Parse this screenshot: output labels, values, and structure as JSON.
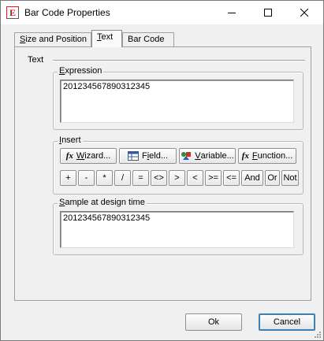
{
  "window": {
    "title": "Bar Code Properties",
    "icon_letter": "E"
  },
  "tabs": [
    {
      "label": "Size and Position",
      "underline": "S",
      "rest": "ize and Position",
      "active": false
    },
    {
      "label": "Text",
      "underline": "T",
      "rest": "ext",
      "active": true
    },
    {
      "label": "Bar Code",
      "underline": "",
      "rest": "Bar Code",
      "active": false
    }
  ],
  "panel": {
    "section_label": "Text",
    "expression": {
      "caption_underline": "E",
      "caption_rest": "xpression",
      "value": "201234567890312345"
    },
    "insert": {
      "caption_underline": "I",
      "caption_rest": "nsert",
      "wizard_u": "W",
      "wizard_rest": "izard...",
      "field_pre": "F",
      "field_u": "i",
      "field_rest": "eld...",
      "variable_u": "V",
      "variable_rest": "ariable...",
      "function_u": "F",
      "function_rest": "unction...",
      "operators": [
        "+",
        "-",
        "*",
        "/",
        "=",
        "<>",
        ">",
        "<",
        ">=",
        "<=",
        "And",
        "Or",
        "Not"
      ]
    },
    "sample": {
      "caption_underline": "S",
      "caption_rest": "ample at design time",
      "value": "201234567890312345"
    }
  },
  "footer": {
    "ok_label": "Ok",
    "cancel_label": "Cancel"
  }
}
